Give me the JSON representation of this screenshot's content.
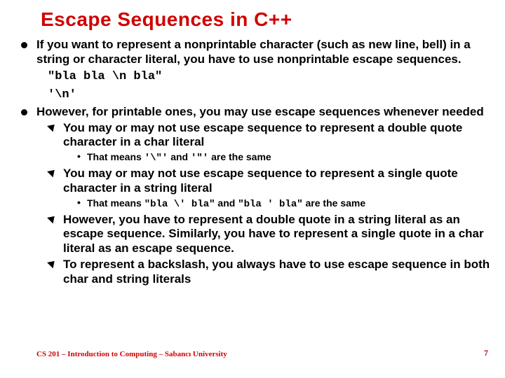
{
  "title": "Escape Sequences in C++",
  "bullets": [
    {
      "text": "If you want to represent a nonprintable character (such as new line, bell) in a string or character literal, you have to use nonprintable escape sequences.",
      "code_lines": [
        "\"bla bla \\n bla\"",
        "'\\n'"
      ]
    },
    {
      "text": "However, for printable ones, you may use escape sequences whenever needed",
      "sub": [
        {
          "text": "You may or may not use escape sequence to represent a double quote character in a char literal",
          "sub2": {
            "prefix": "That means ",
            "code1": "'\\\"'",
            "mid": " and ",
            "code2": "'\"'",
            "suffix": " are the same"
          }
        },
        {
          "text": "You may or may not use escape sequence to represent a single quote character in a string literal",
          "sub2": {
            "prefix": "That means ",
            "code1": "\"bla \\'  bla\"",
            "mid": " and ",
            "code2": "\"bla '  bla\"",
            "suffix": " are the same"
          }
        },
        {
          "text": "However, you have to represent a double quote in a string literal as an escape sequence. Similarly, you have to represent a single quote in a char literal as an escape sequence."
        },
        {
          "text": "To represent a backslash, you always have to use escape sequence in both char and string literals"
        }
      ]
    }
  ],
  "footer": "CS 201 – Introduction to Computing – Sabancı University",
  "page": "7"
}
